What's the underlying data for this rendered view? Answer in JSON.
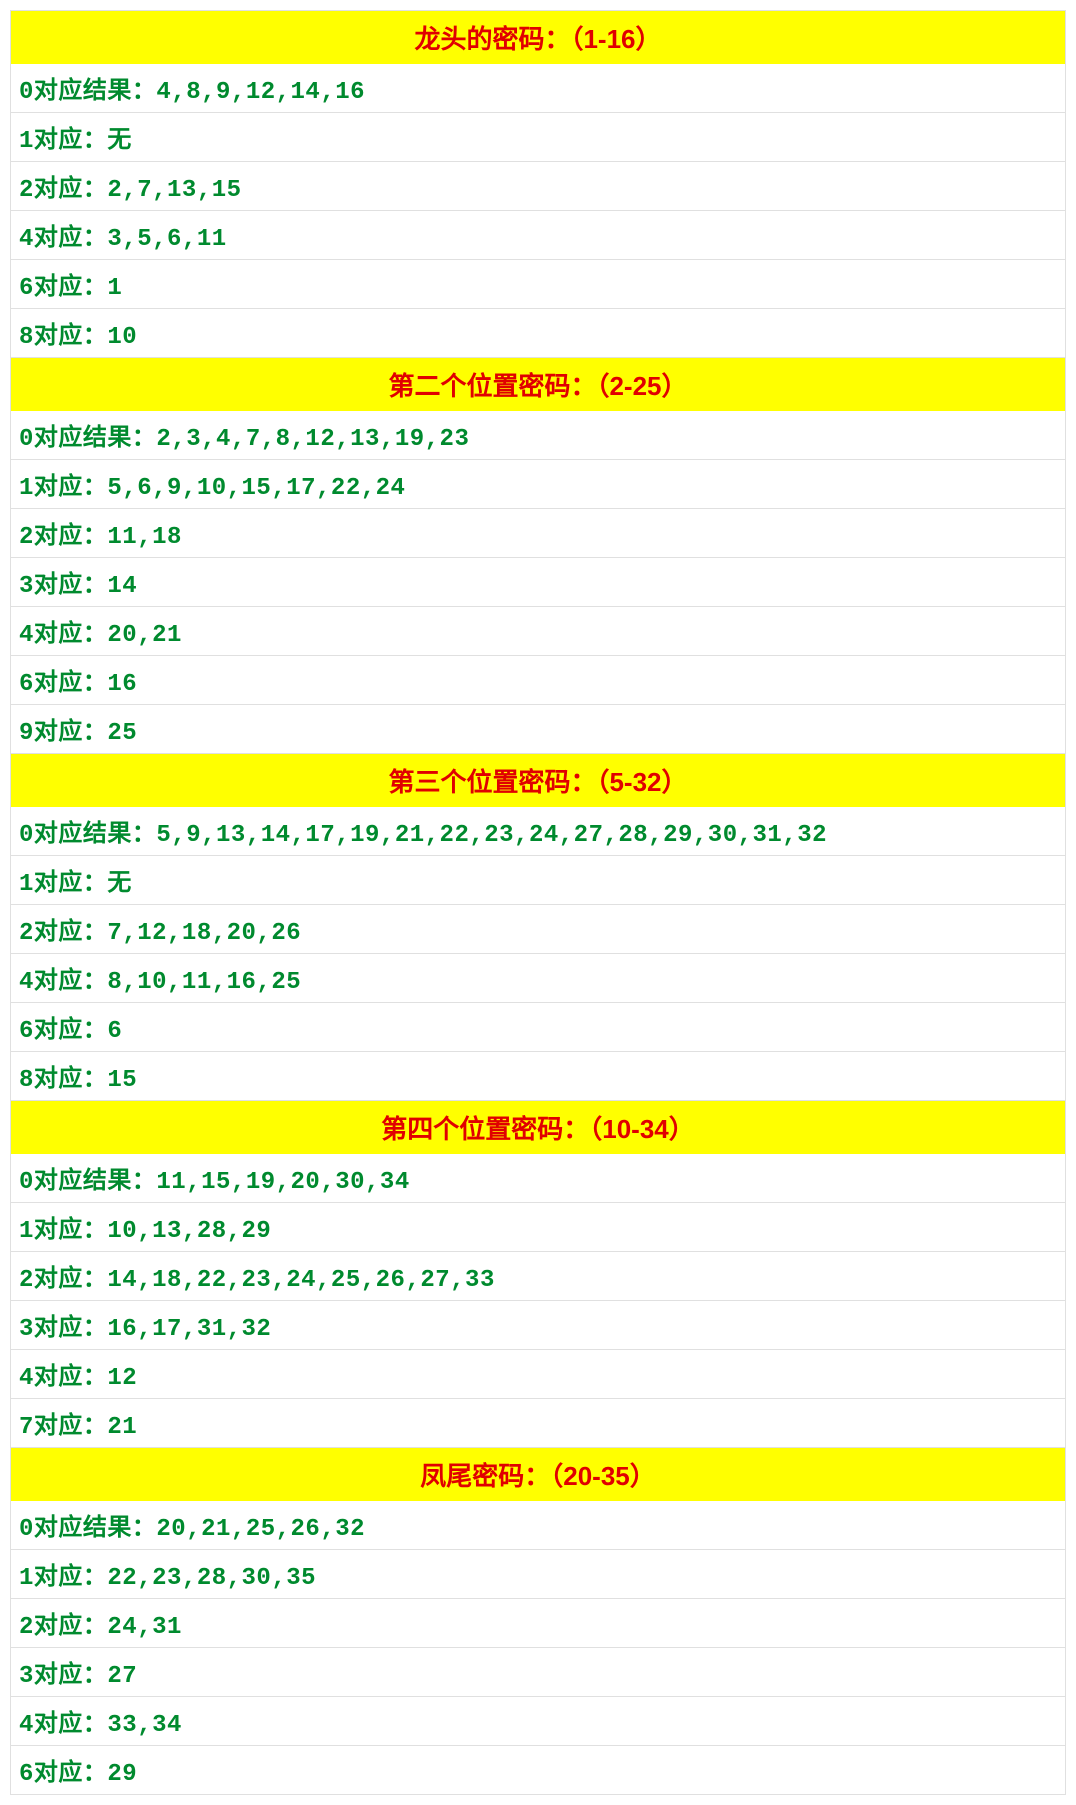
{
  "sections": [
    {
      "title": "龙头的密码：（1-16）",
      "rows": [
        "0对应结果：4,8,9,12,14,16",
        "1对应：无",
        "2对应：2,7,13,15",
        "4对应：3,5,6,11",
        "6对应：1",
        "8对应：10"
      ]
    },
    {
      "title": "第二个位置密码：（2-25）",
      "rows": [
        "0对应结果：2,3,4,7,8,12,13,19,23",
        "1对应：5,6,9,10,15,17,22,24",
        "2对应：11,18",
        "3对应：14",
        "4对应：20,21",
        "6对应：16",
        "9对应：25"
      ]
    },
    {
      "title": "第三个位置密码：（5-32）",
      "rows": [
        "0对应结果：5,9,13,14,17,19,21,22,23,24,27,28,29,30,31,32",
        "1对应：无",
        "2对应：7,12,18,20,26",
        "4对应：8,10,11,16,25",
        "6对应：6",
        "8对应：15"
      ]
    },
    {
      "title": "第四个位置密码：（10-34）",
      "rows": [
        "0对应结果：11,15,19,20,30,34",
        "1对应：10,13,28,29",
        "2对应：14,18,22,23,24,25,26,27,33",
        "3对应：16,17,31,32",
        "4对应：12",
        "7对应：21"
      ]
    },
    {
      "title": "凤尾密码：（20-35）",
      "rows": [
        "0对应结果：20,21,25,26,32",
        "1对应：22,23,28,30,35",
        "2对应：24,31",
        "3对应：27",
        "4对应：33,34",
        "6对应：29"
      ]
    }
  ]
}
